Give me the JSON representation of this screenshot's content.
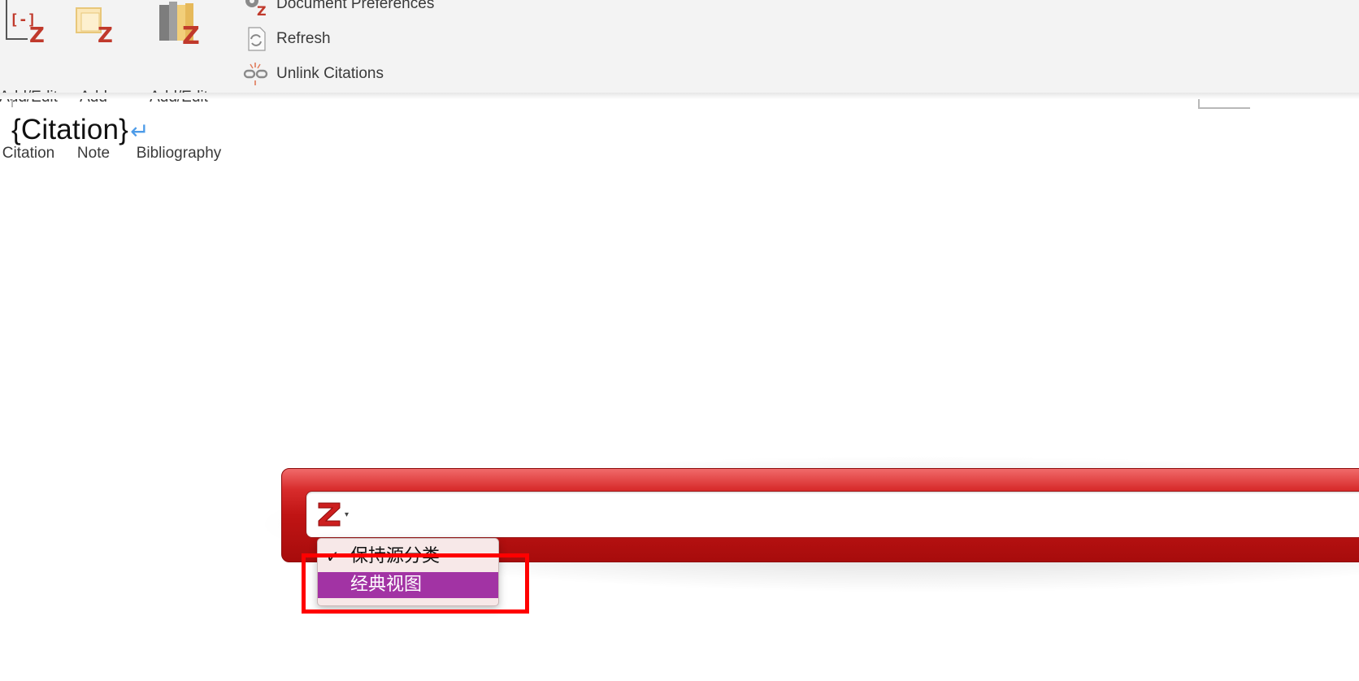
{
  "ribbon": {
    "add_edit_citation": {
      "line1": "Add/Edit",
      "line2": "Citation"
    },
    "add_note": {
      "line1": "Add",
      "line2": "Note"
    },
    "add_edit_bibliography": {
      "line1": "Add/Edit",
      "line2": "Bibliography"
    },
    "document_preferences": "Document Preferences",
    "refresh": "Refresh",
    "unlink_citations": "Unlink Citations",
    "icon_badge": "Z"
  },
  "document": {
    "text": "{Citation}",
    "paragraph_mark": "↵"
  },
  "quick_format": {
    "logo": "Z",
    "dropdown_arrow": "▾",
    "menu": {
      "items": [
        {
          "label": "保持源分类",
          "checked": true,
          "check_glyph": "✓"
        },
        {
          "label": "经典视图",
          "checked": false,
          "selected": true
        }
      ]
    }
  },
  "colors": {
    "zotero_red": "#c01414",
    "menu_selected": "#a233a4",
    "annotation_box": "#ff0000"
  }
}
